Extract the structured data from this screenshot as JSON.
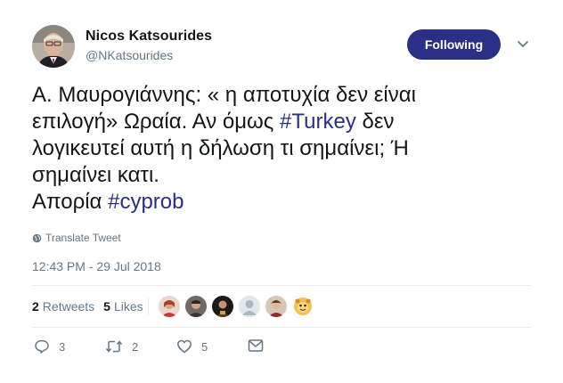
{
  "author": {
    "name": "Nicos Katsourides",
    "handle": "@NKatsourides"
  },
  "follow_button": {
    "label": "Following"
  },
  "tweet": {
    "line1": "Α. Μαυρογιάννης: « η αποτυχία δεν είναι",
    "line2_pre": "επιλογή» Ωραία. Αν όμως ",
    "line2_hashtag": "#Turkey",
    "line2_post": " δεν",
    "line3": "λογικευτεί αυτή η δήλωση τι σημαίνει; Ή",
    "line4": "σημαίνει κατι.",
    "line5_pre": "Απορία ",
    "line5_hashtag": "#cyprob"
  },
  "translate_label": "Translate Tweet",
  "timestamp": "12:43 PM - 29 Jul 2018",
  "stats": {
    "retweets_count": "2",
    "retweets_label": "Retweets",
    "likes_count": "5",
    "likes_label": "Likes"
  },
  "actions": {
    "reply_count": "3",
    "retweet_count": "2",
    "like_count": "5"
  },
  "colors": {
    "accent": "#2a3088",
    "secondary_text": "#657786",
    "divider": "#e6ecf0"
  },
  "icons": [
    "globe-icon",
    "chevron-down-icon",
    "reply-icon",
    "retweet-icon",
    "heart-icon",
    "message-icon"
  ]
}
